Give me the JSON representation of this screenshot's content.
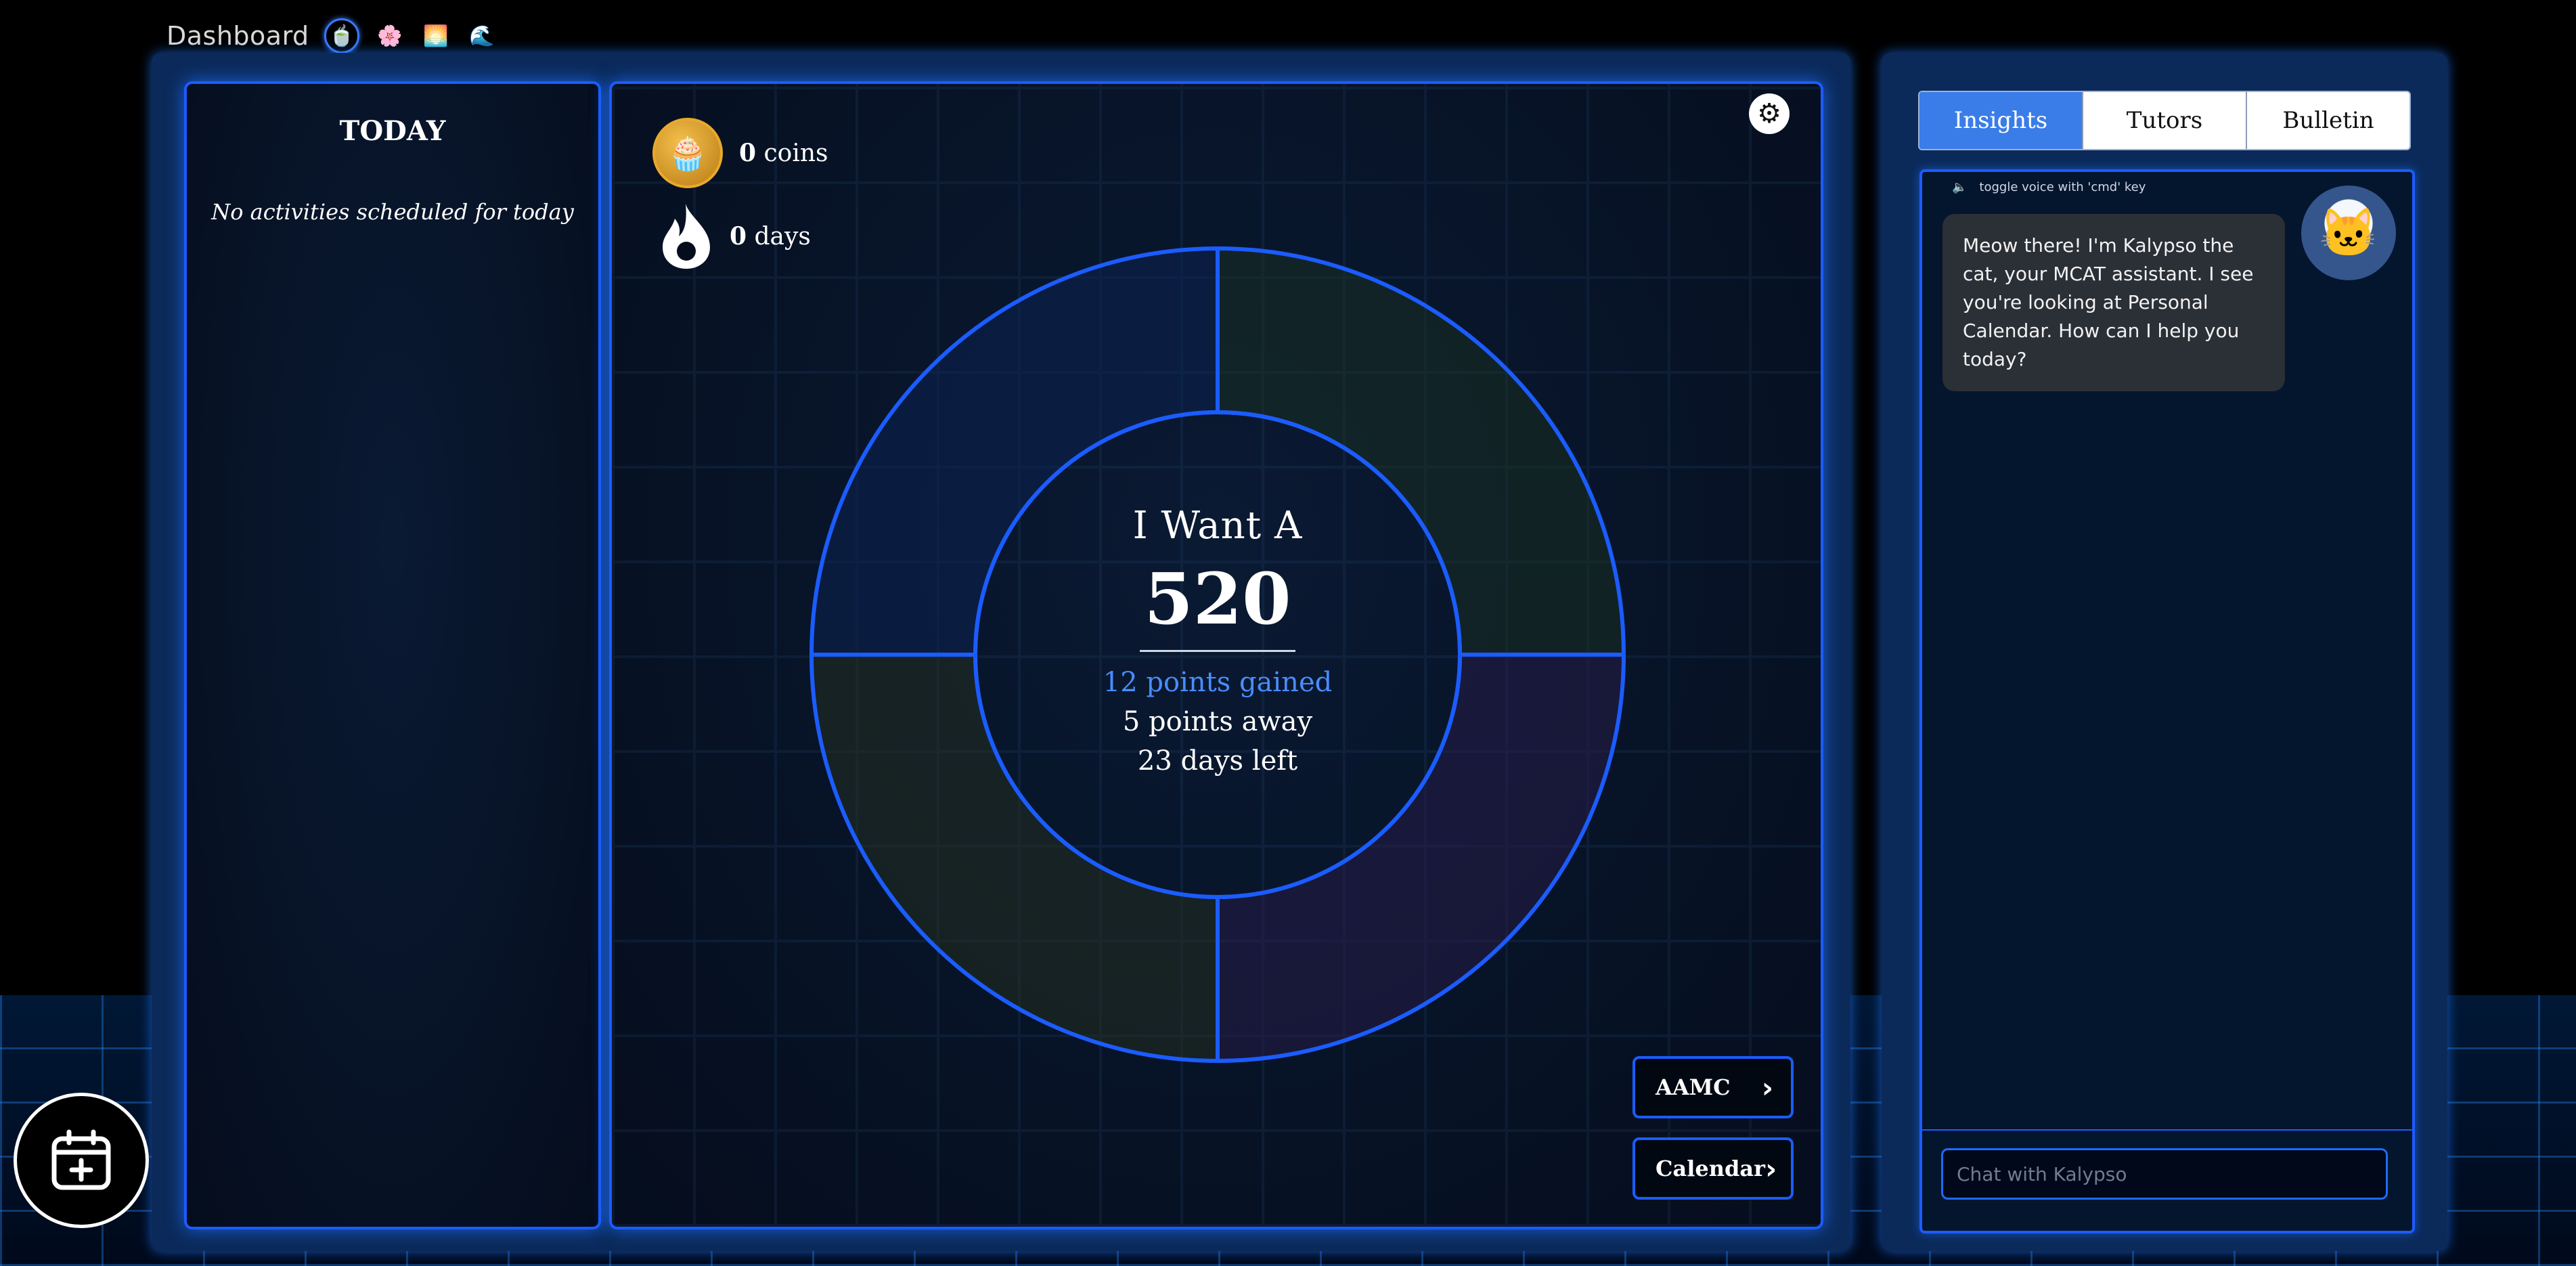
{
  "header": {
    "title": "Dashboard",
    "themes": [
      {
        "icon": "🍵",
        "name": "cyber-theme-icon"
      },
      {
        "icon": "🌸",
        "name": "sakura-theme-icon"
      },
      {
        "icon": "🌅",
        "name": "sunset-theme-icon"
      },
      {
        "icon": "🌊",
        "name": "ocean-theme-icon"
      }
    ]
  },
  "today": {
    "heading": "TODAY",
    "empty_message": "No activities scheduled for today"
  },
  "stats": {
    "coins_count": "0",
    "coins_label": "coins",
    "streak_count": "0",
    "streak_label": "days"
  },
  "goal": {
    "label": "I Want A",
    "score": "520",
    "gained": "12 points gained",
    "away": "5 points away",
    "days_left": "23 days left"
  },
  "buttons": {
    "aamc": "AAMC",
    "calendar": "Calendar"
  },
  "sidebar": {
    "tabs": [
      {
        "label": "Insights",
        "active": true
      },
      {
        "label": "Tutors",
        "active": false
      },
      {
        "label": "Bulletin",
        "active": false
      }
    ],
    "voice_hint": "toggle voice with 'cmd' key",
    "message": "Meow there! I'm Kalypso the cat, your MCAT assistant. I see you're looking at Personal Calendar. How can I help you today?",
    "input_placeholder": "Chat with Kalypso"
  },
  "colors": {
    "accent": "#1b5cff",
    "tab_active": "#3a7de8",
    "gained_text": "#4a8cff"
  }
}
